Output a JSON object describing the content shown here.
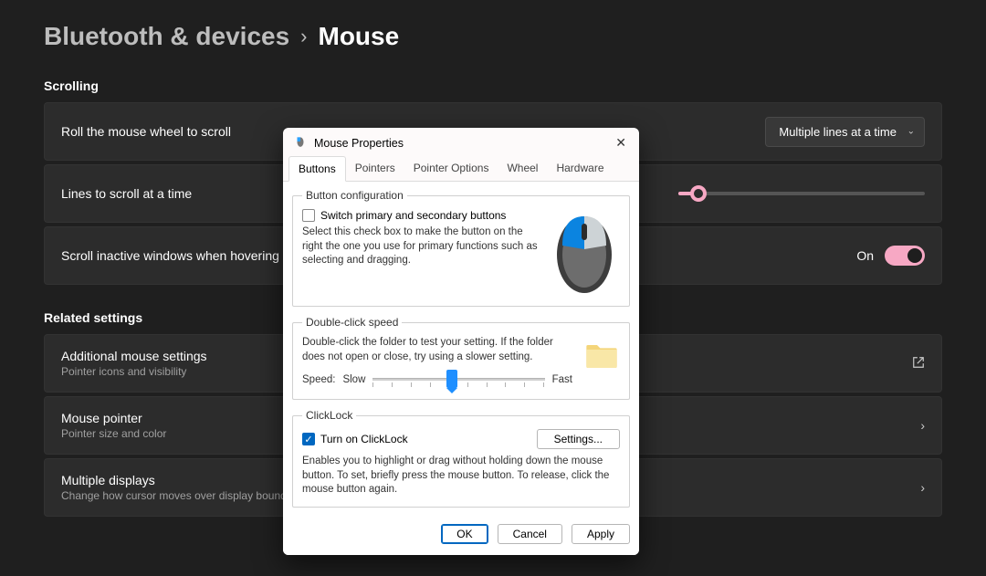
{
  "breadcrumb": {
    "parent": "Bluetooth & devices",
    "current": "Mouse"
  },
  "sections": {
    "scrolling_header": "Scrolling",
    "related_header": "Related settings"
  },
  "rows": {
    "roll_wheel": {
      "title": "Roll the mouse wheel to scroll",
      "dropdown_value": "Multiple lines at a time"
    },
    "lines_scroll": {
      "title": "Lines to scroll at a time"
    },
    "inactive_hover": {
      "title": "Scroll inactive windows when hovering over them",
      "toggle_label": "On"
    },
    "additional": {
      "title": "Additional mouse settings",
      "sub": "Pointer icons and visibility"
    },
    "pointer": {
      "title": "Mouse pointer",
      "sub": "Pointer size and color"
    },
    "displays": {
      "title": "Multiple displays",
      "sub": "Change how cursor moves over display boundaries"
    }
  },
  "dialog": {
    "title": "Mouse Properties",
    "tabs": {
      "buttons": "Buttons",
      "pointers": "Pointers",
      "pointer_options": "Pointer Options",
      "wheel": "Wheel",
      "hardware": "Hardware"
    },
    "button_config": {
      "legend": "Button configuration",
      "checkbox_label": "Switch primary and secondary buttons",
      "desc": "Select this check box to make the button on the right the one you use for primary functions such as selecting and dragging."
    },
    "double_click": {
      "legend": "Double-click speed",
      "desc": "Double-click the folder to test your setting. If the folder does not open or close, try using a slower setting.",
      "speed_label": "Speed:",
      "slow": "Slow",
      "fast": "Fast"
    },
    "clicklock": {
      "legend": "ClickLock",
      "checkbox_label": "Turn on ClickLock",
      "settings_btn": "Settings...",
      "desc": "Enables you to highlight or drag without holding down the mouse button. To set, briefly press the mouse button. To release, click the mouse button again."
    },
    "footer": {
      "ok": "OK",
      "cancel": "Cancel",
      "apply": "Apply"
    }
  }
}
